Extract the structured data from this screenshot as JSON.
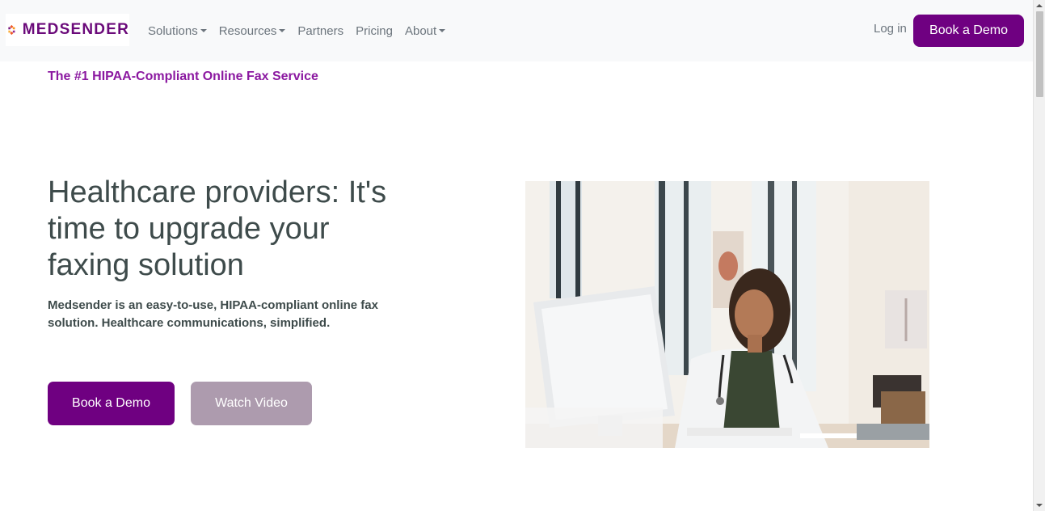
{
  "brand": {
    "name": "MEDSENDER",
    "logo_icon": "medsender-logo-icon"
  },
  "nav": {
    "items": [
      {
        "label": "Solutions",
        "has_dropdown": true
      },
      {
        "label": "Resources",
        "has_dropdown": true
      },
      {
        "label": "Partners",
        "has_dropdown": false
      },
      {
        "label": "Pricing",
        "has_dropdown": false
      },
      {
        "label": "About",
        "has_dropdown": true
      }
    ],
    "login_label": "Log in",
    "cta_label": "Book a Demo"
  },
  "hero": {
    "tagline": "The #1 HIPAA-Compliant Online Fax Service",
    "headline": "Healthcare providers: It's time to upgrade your faxing solution",
    "subtext": "Medsender is an easy-to-use, HIPAA-compliant online fax solution. Healthcare communications, simplified.",
    "primary_button": "Book a Demo",
    "secondary_button": "Watch Video",
    "image_subject": "doctor-at-computer-photo"
  },
  "colors": {
    "brand_purple": "#6f0081",
    "tagline_purple": "#8b18a0",
    "muted_button": "#ad9bae",
    "navbar_bg": "#f8f9fa"
  }
}
